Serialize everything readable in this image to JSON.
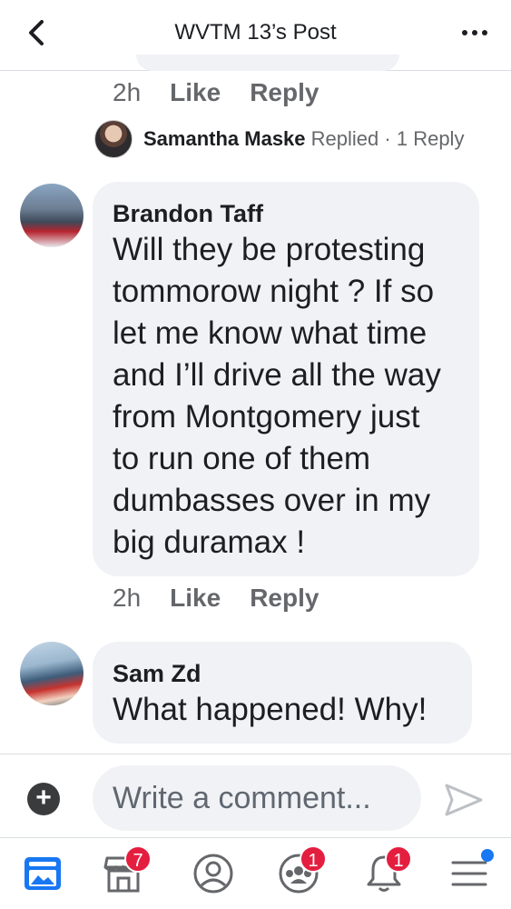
{
  "header": {
    "title": "WVTM 13’s Post"
  },
  "prev_comment": {
    "time": "2h",
    "like_label": "Like",
    "reply_label": "Reply",
    "replies": {
      "name": "Samantha Maske",
      "action": "Replied",
      "separator": "·",
      "count_label": "1 Reply"
    }
  },
  "comments": [
    {
      "author": "Brandon Taff",
      "lines": [
        "Will they be protesting",
        "tommorow night ? If so",
        "let me know what time",
        "and I’ll drive all the way",
        "from Montgomery just",
        "to run one of them",
        "dumbasses over in my",
        "big duramax !"
      ],
      "time": "2h",
      "like_label": "Like",
      "reply_label": "Reply"
    },
    {
      "author": "Sam Zd",
      "lines": [
        "What happened! Why!"
      ]
    }
  ],
  "composer": {
    "placeholder": "Write a comment..."
  },
  "tabbar": {
    "marketplace_badge": "7",
    "groups_badge": "1",
    "notifications_badge": "1"
  },
  "colors": {
    "bubble": "#f0f2f5",
    "badge": "#e41e3f",
    "accent": "#1877f2",
    "muted_text": "#65676b"
  }
}
